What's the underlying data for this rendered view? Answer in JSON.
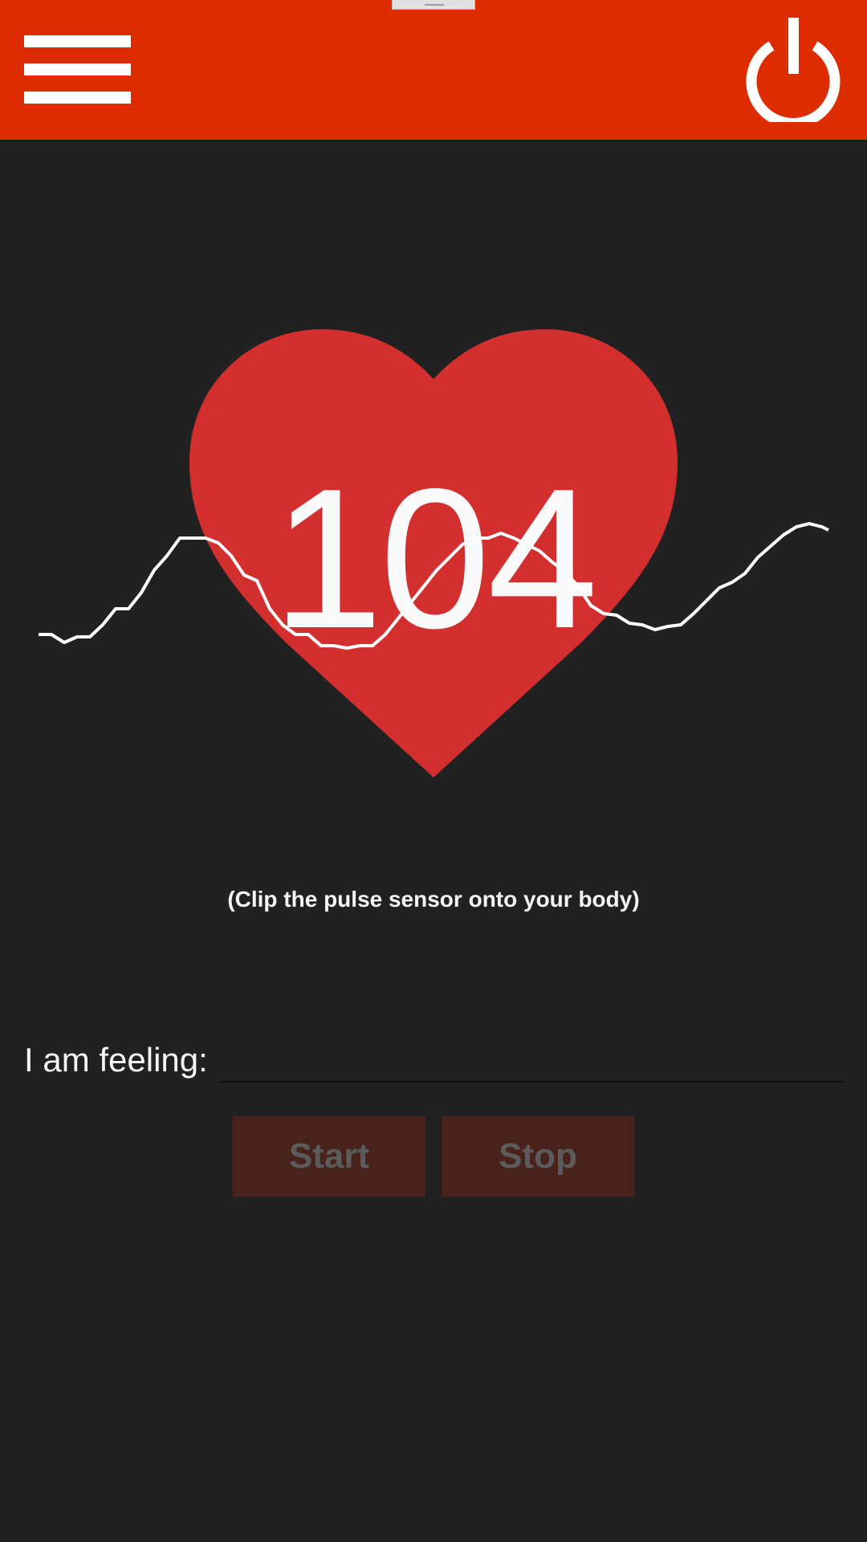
{
  "header": {
    "background": "#dd2c00",
    "menu_icon": "hamburger-menu-icon",
    "power_icon": "power-icon"
  },
  "heart": {
    "color": "#d32f2f",
    "bpm": "104"
  },
  "pulse_wave": {
    "color": "#ffffff"
  },
  "hint_text": "(Clip the pulse sensor onto your body)",
  "feeling": {
    "label": "I am feeling:",
    "value": ""
  },
  "buttons": {
    "start_label": "Start",
    "stop_label": "Stop",
    "background": "#4a221c"
  }
}
